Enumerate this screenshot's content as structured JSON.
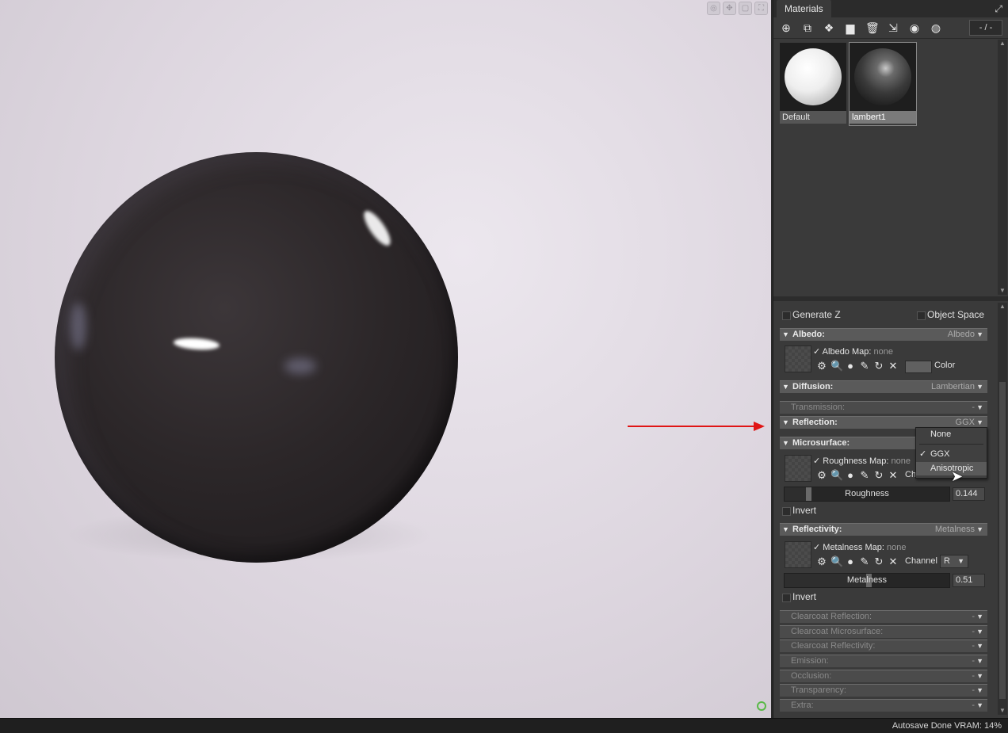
{
  "panel": {
    "tab_title": "Materials",
    "popout_icon": "popout-icon",
    "toolbar_icons": [
      "add-material-icon",
      "duplicate-icon",
      "checker-icon",
      "folder-icon",
      "trash-icon",
      "import-icon",
      "select-icon",
      "link-icon"
    ],
    "page_counter": "- / -"
  },
  "materials": [
    {
      "name": "Default",
      "selected": false
    },
    {
      "name": "lambert1",
      "selected": true
    }
  ],
  "properties": {
    "generate_z": "Generate Z",
    "object_space": "Object Space",
    "albedo": {
      "title": "Albedo:",
      "value": "Albedo",
      "map_label": "Albedo Map:",
      "map_value": "none",
      "color_label": "Color"
    },
    "diffusion": {
      "title": "Diffusion:",
      "value": "Lambertian"
    },
    "transmission": {
      "title": "Transmission:",
      "value": "-"
    },
    "reflection": {
      "title": "Reflection:",
      "value": "GGX"
    },
    "microsurface": {
      "title": "Microsurface:",
      "map_label": "Roughness Map:",
      "map_value": "none",
      "channel_label": "Channel",
      "slider_label": "Roughness",
      "slider_value": "0.144",
      "slider_fraction": 0.144,
      "invert_label": "Invert"
    },
    "reflectivity": {
      "title": "Reflectivity:",
      "value": "Metalness",
      "map_label": "Metalness Map:",
      "map_value": "none",
      "channel_label": "Channel",
      "channel_value": "R",
      "slider_label": "Metalness",
      "slider_value": "0.51",
      "slider_fraction": 0.51,
      "invert_label": "Invert"
    },
    "collapsed_sections": [
      {
        "title": "Clearcoat Reflection:",
        "value": "-"
      },
      {
        "title": "Clearcoat Microsurface:",
        "value": "-"
      },
      {
        "title": "Clearcoat Reflectivity:",
        "value": "-"
      },
      {
        "title": "Emission:",
        "value": "-"
      },
      {
        "title": "Occlusion:",
        "value": "-"
      },
      {
        "title": "Transparency:",
        "value": "-"
      },
      {
        "title": "Extra:",
        "value": "-"
      }
    ]
  },
  "reflection_dropdown": {
    "options": [
      "None",
      "GGX",
      "Anisotropic"
    ],
    "checked": "GGX",
    "hovered": "Anisotropic"
  },
  "status": {
    "text": "Autosave Done   VRAM: 14%"
  },
  "colors": {
    "annotation_arrow": "#e01515",
    "accent_green": "#59b947"
  }
}
